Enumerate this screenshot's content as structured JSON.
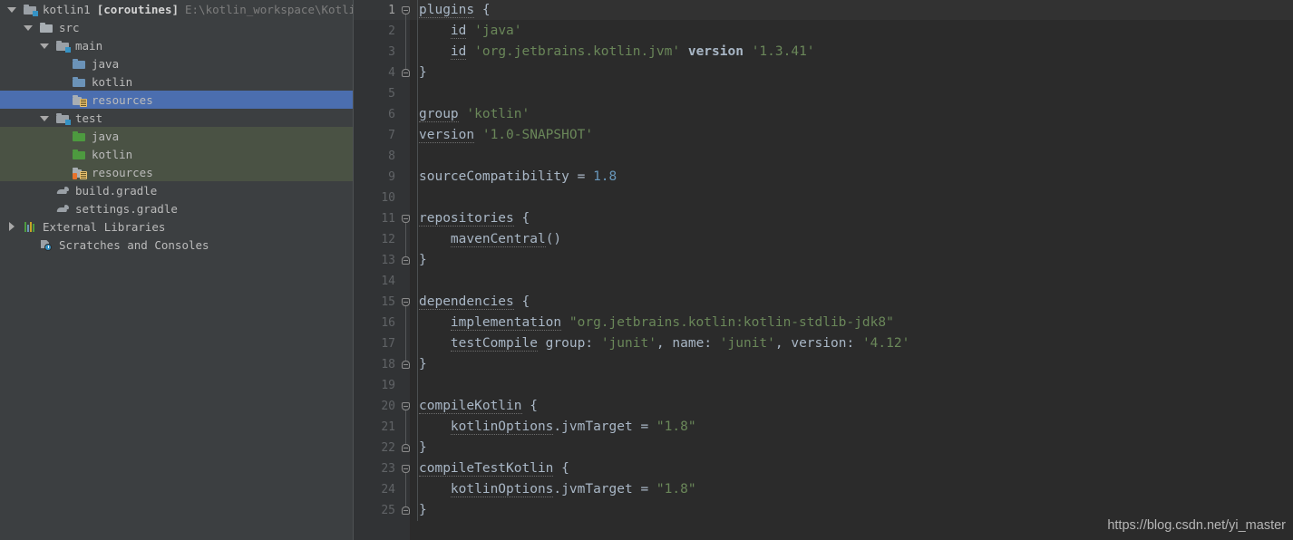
{
  "project": {
    "name": "kotlin1",
    "module": "[coroutines]",
    "path": "E:\\kotlin_workspace\\KotlineTe"
  },
  "sidebar": {
    "items": [
      {
        "label": "kotlin1",
        "secondary": "[coroutines]",
        "path": "E:\\kotlin_workspace\\KotlineTe",
        "icon": "project-folder-icon",
        "arrow": "down",
        "indent": 0,
        "state": "normal"
      },
      {
        "label": "src",
        "icon": "folder-icon",
        "arrow": "down",
        "indent": 1,
        "state": "normal"
      },
      {
        "label": "main",
        "icon": "module-folder-icon",
        "arrow": "down",
        "indent": 2,
        "state": "normal"
      },
      {
        "label": "java",
        "icon": "source-folder-icon",
        "arrow": "none",
        "indent": 3,
        "state": "normal"
      },
      {
        "label": "kotlin",
        "icon": "source-folder-icon",
        "arrow": "none",
        "indent": 3,
        "state": "normal"
      },
      {
        "label": "resources",
        "icon": "resources-folder-icon",
        "arrow": "none",
        "indent": 3,
        "state": "selected"
      },
      {
        "label": "test",
        "icon": "module-folder-icon",
        "arrow": "down",
        "indent": 2,
        "state": "normal"
      },
      {
        "label": "java",
        "icon": "test-source-folder-icon",
        "arrow": "none",
        "indent": 3,
        "state": "test"
      },
      {
        "label": "kotlin",
        "icon": "test-source-folder-icon",
        "arrow": "none",
        "indent": 3,
        "state": "test"
      },
      {
        "label": "resources",
        "icon": "test-resources-folder-icon",
        "arrow": "none",
        "indent": 3,
        "state": "test"
      },
      {
        "label": "build.gradle",
        "icon": "gradle-file-icon",
        "arrow": "none",
        "indent": 2,
        "state": "normal"
      },
      {
        "label": "settings.gradle",
        "icon": "gradle-file-icon",
        "arrow": "none",
        "indent": 2,
        "state": "normal"
      },
      {
        "label": "External Libraries",
        "icon": "libraries-icon",
        "arrow": "right",
        "indent": 0,
        "state": "normal"
      },
      {
        "label": "Scratches and Consoles",
        "icon": "scratches-icon",
        "arrow": "none",
        "indent": 1,
        "state": "normal"
      }
    ]
  },
  "editor": {
    "current_line": 1,
    "lines": [
      {
        "n": 1,
        "fold": "open",
        "tokens": [
          {
            "t": "plugins",
            "c": "def-dotted"
          },
          {
            "t": " {",
            "c": "punc"
          }
        ]
      },
      {
        "n": 2,
        "tokens": [
          {
            "t": "    ",
            "c": "punc"
          },
          {
            "t": "id",
            "c": "def-dotted"
          },
          {
            "t": " ",
            "c": "punc"
          },
          {
            "t": "'java'",
            "c": "str"
          }
        ]
      },
      {
        "n": 3,
        "tokens": [
          {
            "t": "    ",
            "c": "punc"
          },
          {
            "t": "id",
            "c": "def-dotted"
          },
          {
            "t": " ",
            "c": "punc"
          },
          {
            "t": "'org.jetbrains.kotlin.jvm'",
            "c": "str"
          },
          {
            "t": " ",
            "c": "punc"
          },
          {
            "t": "version",
            "c": "kw"
          },
          {
            "t": " ",
            "c": "punc"
          },
          {
            "t": "'1.3.41'",
            "c": "str"
          }
        ]
      },
      {
        "n": 4,
        "fold": "close",
        "tokens": [
          {
            "t": "}",
            "c": "punc"
          }
        ]
      },
      {
        "n": 5,
        "tokens": []
      },
      {
        "n": 6,
        "tokens": [
          {
            "t": "group",
            "c": "def-dotted"
          },
          {
            "t": " ",
            "c": "punc"
          },
          {
            "t": "'kotlin'",
            "c": "str"
          }
        ]
      },
      {
        "n": 7,
        "tokens": [
          {
            "t": "version",
            "c": "def-dotted"
          },
          {
            "t": " ",
            "c": "punc"
          },
          {
            "t": "'1.0-SNAPSHOT'",
            "c": "str"
          }
        ]
      },
      {
        "n": 8,
        "tokens": []
      },
      {
        "n": 9,
        "tokens": [
          {
            "t": "sourceCompatibility",
            "c": "punc"
          },
          {
            "t": " = ",
            "c": "punc"
          },
          {
            "t": "1.8",
            "c": "num"
          }
        ]
      },
      {
        "n": 10,
        "tokens": []
      },
      {
        "n": 11,
        "fold": "open",
        "tokens": [
          {
            "t": "repositories",
            "c": "def-dotted"
          },
          {
            "t": " {",
            "c": "punc"
          }
        ]
      },
      {
        "n": 12,
        "tokens": [
          {
            "t": "    ",
            "c": "punc"
          },
          {
            "t": "mavenCentral",
            "c": "def-dotted"
          },
          {
            "t": "()",
            "c": "punc"
          }
        ]
      },
      {
        "n": 13,
        "fold": "close",
        "tokens": [
          {
            "t": "}",
            "c": "punc"
          }
        ]
      },
      {
        "n": 14,
        "tokens": []
      },
      {
        "n": 15,
        "fold": "open",
        "tokens": [
          {
            "t": "dependencies",
            "c": "def-dotted"
          },
          {
            "t": " {",
            "c": "punc"
          }
        ]
      },
      {
        "n": 16,
        "tokens": [
          {
            "t": "    ",
            "c": "punc"
          },
          {
            "t": "implementation",
            "c": "def-dotted"
          },
          {
            "t": " ",
            "c": "punc"
          },
          {
            "t": "\"org.jetbrains.kotlin:kotlin-stdlib-jdk8\"",
            "c": "str"
          }
        ]
      },
      {
        "n": 17,
        "tokens": [
          {
            "t": "    ",
            "c": "punc"
          },
          {
            "t": "testCompile",
            "c": "def-dotted"
          },
          {
            "t": " group",
            "c": "punc"
          },
          {
            "t": ":",
            "c": "punc"
          },
          {
            "t": " ",
            "c": "punc"
          },
          {
            "t": "'junit'",
            "c": "str"
          },
          {
            "t": ", name",
            "c": "punc"
          },
          {
            "t": ":",
            "c": "punc"
          },
          {
            "t": " ",
            "c": "punc"
          },
          {
            "t": "'junit'",
            "c": "str"
          },
          {
            "t": ", version",
            "c": "punc"
          },
          {
            "t": ":",
            "c": "punc"
          },
          {
            "t": " ",
            "c": "punc"
          },
          {
            "t": "'4.12'",
            "c": "str"
          }
        ]
      },
      {
        "n": 18,
        "fold": "close",
        "tokens": [
          {
            "t": "}",
            "c": "punc"
          }
        ]
      },
      {
        "n": 19,
        "tokens": []
      },
      {
        "n": 20,
        "fold": "open",
        "tokens": [
          {
            "t": "compileKotlin",
            "c": "def-dotted"
          },
          {
            "t": " {",
            "c": "punc"
          }
        ]
      },
      {
        "n": 21,
        "tokens": [
          {
            "t": "    ",
            "c": "punc"
          },
          {
            "t": "kotlinOptions",
            "c": "def-dotted"
          },
          {
            "t": ".jvmTarget = ",
            "c": "punc"
          },
          {
            "t": "\"1.8\"",
            "c": "str"
          }
        ]
      },
      {
        "n": 22,
        "fold": "close",
        "tokens": [
          {
            "t": "}",
            "c": "punc"
          }
        ]
      },
      {
        "n": 23,
        "fold": "open",
        "tokens": [
          {
            "t": "compileTestKotlin",
            "c": "def-dotted"
          },
          {
            "t": " {",
            "c": "punc"
          }
        ]
      },
      {
        "n": 24,
        "tokens": [
          {
            "t": "    ",
            "c": "punc"
          },
          {
            "t": "kotlinOptions",
            "c": "def-dotted"
          },
          {
            "t": ".jvmTarget = ",
            "c": "punc"
          },
          {
            "t": "\"1.8\"",
            "c": "str"
          }
        ]
      },
      {
        "n": 25,
        "fold": "close",
        "tokens": [
          {
            "t": "}",
            "c": "punc"
          }
        ]
      }
    ]
  },
  "watermark": "https://blog.csdn.net/yi_master",
  "colors": {
    "sidebar_bg": "#3c3f41",
    "editor_bg": "#2b2b2b",
    "gutter_bg": "#313335",
    "selection_blue": "#4b6eaf",
    "test_root_green": "#4a5244",
    "string_green": "#6a8759",
    "number_blue": "#6897bb",
    "default_text": "#a9b7c6"
  }
}
